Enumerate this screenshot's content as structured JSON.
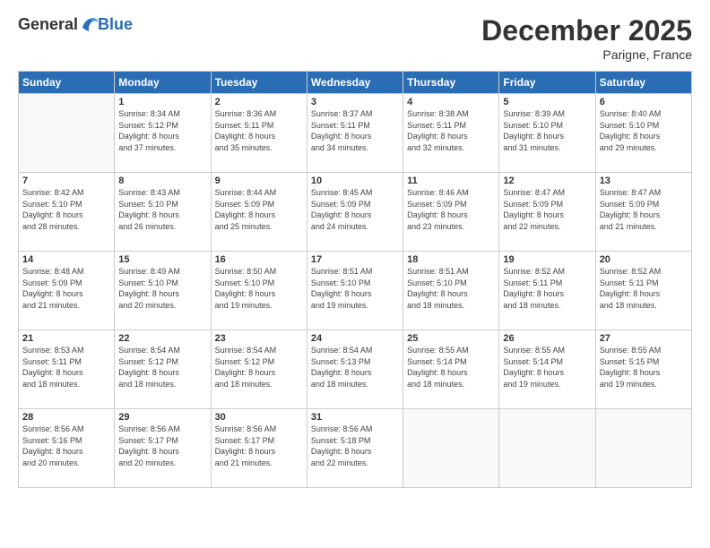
{
  "logo": {
    "general": "General",
    "blue": "Blue"
  },
  "header": {
    "month": "December 2025",
    "location": "Parigne, France"
  },
  "weekdays": [
    "Sunday",
    "Monday",
    "Tuesday",
    "Wednesday",
    "Thursday",
    "Friday",
    "Saturday"
  ],
  "weeks": [
    [
      {
        "day": "",
        "sunrise": "",
        "sunset": "",
        "daylight": ""
      },
      {
        "day": "1",
        "sunrise": "Sunrise: 8:34 AM",
        "sunset": "Sunset: 5:12 PM",
        "daylight": "Daylight: 8 hours and 37 minutes."
      },
      {
        "day": "2",
        "sunrise": "Sunrise: 8:36 AM",
        "sunset": "Sunset: 5:11 PM",
        "daylight": "Daylight: 8 hours and 35 minutes."
      },
      {
        "day": "3",
        "sunrise": "Sunrise: 8:37 AM",
        "sunset": "Sunset: 5:11 PM",
        "daylight": "Daylight: 8 hours and 34 minutes."
      },
      {
        "day": "4",
        "sunrise": "Sunrise: 8:38 AM",
        "sunset": "Sunset: 5:11 PM",
        "daylight": "Daylight: 8 hours and 32 minutes."
      },
      {
        "day": "5",
        "sunrise": "Sunrise: 8:39 AM",
        "sunset": "Sunset: 5:10 PM",
        "daylight": "Daylight: 8 hours and 31 minutes."
      },
      {
        "day": "6",
        "sunrise": "Sunrise: 8:40 AM",
        "sunset": "Sunset: 5:10 PM",
        "daylight": "Daylight: 8 hours and 29 minutes."
      }
    ],
    [
      {
        "day": "7",
        "sunrise": "Sunrise: 8:42 AM",
        "sunset": "Sunset: 5:10 PM",
        "daylight": "Daylight: 8 hours and 28 minutes."
      },
      {
        "day": "8",
        "sunrise": "Sunrise: 8:43 AM",
        "sunset": "Sunset: 5:10 PM",
        "daylight": "Daylight: 8 hours and 26 minutes."
      },
      {
        "day": "9",
        "sunrise": "Sunrise: 8:44 AM",
        "sunset": "Sunset: 5:09 PM",
        "daylight": "Daylight: 8 hours and 25 minutes."
      },
      {
        "day": "10",
        "sunrise": "Sunrise: 8:45 AM",
        "sunset": "Sunset: 5:09 PM",
        "daylight": "Daylight: 8 hours and 24 minutes."
      },
      {
        "day": "11",
        "sunrise": "Sunrise: 8:46 AM",
        "sunset": "Sunset: 5:09 PM",
        "daylight": "Daylight: 8 hours and 23 minutes."
      },
      {
        "day": "12",
        "sunrise": "Sunrise: 8:47 AM",
        "sunset": "Sunset: 5:09 PM",
        "daylight": "Daylight: 8 hours and 22 minutes."
      },
      {
        "day": "13",
        "sunrise": "Sunrise: 8:47 AM",
        "sunset": "Sunset: 5:09 PM",
        "daylight": "Daylight: 8 hours and 21 minutes."
      }
    ],
    [
      {
        "day": "14",
        "sunrise": "Sunrise: 8:48 AM",
        "sunset": "Sunset: 5:09 PM",
        "daylight": "Daylight: 8 hours and 21 minutes."
      },
      {
        "day": "15",
        "sunrise": "Sunrise: 8:49 AM",
        "sunset": "Sunset: 5:10 PM",
        "daylight": "Daylight: 8 hours and 20 minutes."
      },
      {
        "day": "16",
        "sunrise": "Sunrise: 8:50 AM",
        "sunset": "Sunset: 5:10 PM",
        "daylight": "Daylight: 8 hours and 19 minutes."
      },
      {
        "day": "17",
        "sunrise": "Sunrise: 8:51 AM",
        "sunset": "Sunset: 5:10 PM",
        "daylight": "Daylight: 8 hours and 19 minutes."
      },
      {
        "day": "18",
        "sunrise": "Sunrise: 8:51 AM",
        "sunset": "Sunset: 5:10 PM",
        "daylight": "Daylight: 8 hours and 18 minutes."
      },
      {
        "day": "19",
        "sunrise": "Sunrise: 8:52 AM",
        "sunset": "Sunset: 5:11 PM",
        "daylight": "Daylight: 8 hours and 18 minutes."
      },
      {
        "day": "20",
        "sunrise": "Sunrise: 8:52 AM",
        "sunset": "Sunset: 5:11 PM",
        "daylight": "Daylight: 8 hours and 18 minutes."
      }
    ],
    [
      {
        "day": "21",
        "sunrise": "Sunrise: 8:53 AM",
        "sunset": "Sunset: 5:11 PM",
        "daylight": "Daylight: 8 hours and 18 minutes."
      },
      {
        "day": "22",
        "sunrise": "Sunrise: 8:54 AM",
        "sunset": "Sunset: 5:12 PM",
        "daylight": "Daylight: 8 hours and 18 minutes."
      },
      {
        "day": "23",
        "sunrise": "Sunrise: 8:54 AM",
        "sunset": "Sunset: 5:12 PM",
        "daylight": "Daylight: 8 hours and 18 minutes."
      },
      {
        "day": "24",
        "sunrise": "Sunrise: 8:54 AM",
        "sunset": "Sunset: 5:13 PM",
        "daylight": "Daylight: 8 hours and 18 minutes."
      },
      {
        "day": "25",
        "sunrise": "Sunrise: 8:55 AM",
        "sunset": "Sunset: 5:14 PM",
        "daylight": "Daylight: 8 hours and 18 minutes."
      },
      {
        "day": "26",
        "sunrise": "Sunrise: 8:55 AM",
        "sunset": "Sunset: 5:14 PM",
        "daylight": "Daylight: 8 hours and 19 minutes."
      },
      {
        "day": "27",
        "sunrise": "Sunrise: 8:55 AM",
        "sunset": "Sunset: 5:15 PM",
        "daylight": "Daylight: 8 hours and 19 minutes."
      }
    ],
    [
      {
        "day": "28",
        "sunrise": "Sunrise: 8:56 AM",
        "sunset": "Sunset: 5:16 PM",
        "daylight": "Daylight: 8 hours and 20 minutes."
      },
      {
        "day": "29",
        "sunrise": "Sunrise: 8:56 AM",
        "sunset": "Sunset: 5:17 PM",
        "daylight": "Daylight: 8 hours and 20 minutes."
      },
      {
        "day": "30",
        "sunrise": "Sunrise: 8:56 AM",
        "sunset": "Sunset: 5:17 PM",
        "daylight": "Daylight: 8 hours and 21 minutes."
      },
      {
        "day": "31",
        "sunrise": "Sunrise: 8:56 AM",
        "sunset": "Sunset: 5:18 PM",
        "daylight": "Daylight: 8 hours and 22 minutes."
      },
      {
        "day": "",
        "sunrise": "",
        "sunset": "",
        "daylight": ""
      },
      {
        "day": "",
        "sunrise": "",
        "sunset": "",
        "daylight": ""
      },
      {
        "day": "",
        "sunrise": "",
        "sunset": "",
        "daylight": ""
      }
    ]
  ]
}
